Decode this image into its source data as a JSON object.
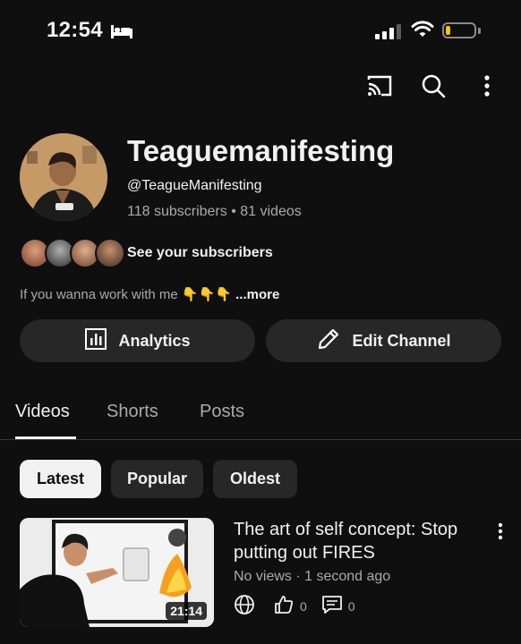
{
  "status_bar": {
    "time": "12:54"
  },
  "channel": {
    "name": "Teaguemanifesting",
    "handle": "@TeagueManifesting",
    "stats": "118 subscribers • 81 videos",
    "see_subscribers": "See your subscribers",
    "description": "If you wanna work with me",
    "description_emoji": "👇👇👇",
    "more": "...more"
  },
  "actions": {
    "analytics": "Analytics",
    "edit_channel": "Edit Channel"
  },
  "tabs": [
    {
      "label": "Videos"
    },
    {
      "label": "Shorts"
    },
    {
      "label": "Posts"
    }
  ],
  "filters": [
    {
      "label": "Latest"
    },
    {
      "label": "Popular"
    },
    {
      "label": "Oldest"
    }
  ],
  "video": {
    "title": "The art of self concept: Stop putting out FIRES",
    "meta": "No views · 1 second ago",
    "duration": "21:14",
    "likes": "0",
    "comments": "0"
  },
  "colors": {
    "background": "#0f0f0f",
    "surface": "#272727",
    "text_primary": "#f1f1f1",
    "text_secondary": "#aaaaaa",
    "battery": "#f5c400"
  },
  "icons": [
    "bed-icon",
    "signal-icon",
    "wifi-icon",
    "battery-icon",
    "cast-icon",
    "search-icon",
    "more-vert-icon",
    "analytics-icon",
    "pencil-icon",
    "globe-icon",
    "thumbs-up-icon",
    "comment-icon"
  ]
}
